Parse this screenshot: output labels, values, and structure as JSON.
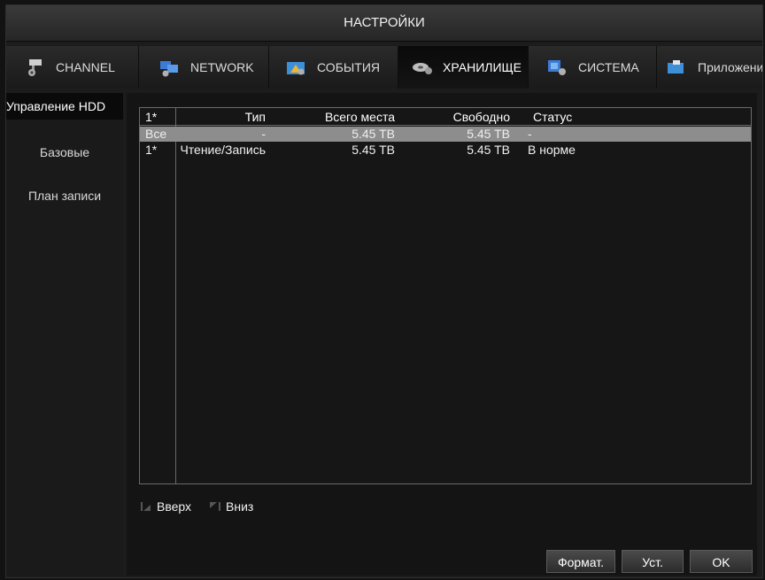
{
  "window": {
    "title": "НАСТРОЙКИ"
  },
  "tabs": [
    {
      "label": "CHANNEL",
      "icon": "camera-icon"
    },
    {
      "label": "NETWORK",
      "icon": "network-icon"
    },
    {
      "label": "СОБЫТИЯ",
      "icon": "events-icon"
    },
    {
      "label": "ХРАНИЛИЩЕ",
      "icon": "storage-icon",
      "active": true
    },
    {
      "label": "СИСТЕМА",
      "icon": "system-icon"
    },
    {
      "label": "Приложения",
      "icon": "apps-icon"
    }
  ],
  "sidebar": {
    "items": [
      {
        "label": "Управление HDD",
        "active": true
      },
      {
        "label": "Базовые"
      },
      {
        "label": "План записи"
      }
    ]
  },
  "table": {
    "headers": {
      "idx": "1*",
      "type": "Тип",
      "total": "Всего места",
      "free": "Свободно",
      "status": "Статус"
    },
    "rows": [
      {
        "idx": "Все",
        "type": "-",
        "total": "5.45 TB",
        "free": "5.45 TB",
        "status": "-"
      },
      {
        "idx": "1*",
        "type": "Чтение/Запись",
        "total": "5.45 TB",
        "free": "5.45 TB",
        "status": "В норме"
      }
    ]
  },
  "nav": {
    "up": "Вверх",
    "down": "Вниз"
  },
  "buttons": {
    "format": "Формат.",
    "set": "Уст.",
    "ok": "OK"
  },
  "colors": {
    "selected_row": "#8d8d8d",
    "background": "#1c1c1c",
    "table_border": "#6a6a6a"
  }
}
